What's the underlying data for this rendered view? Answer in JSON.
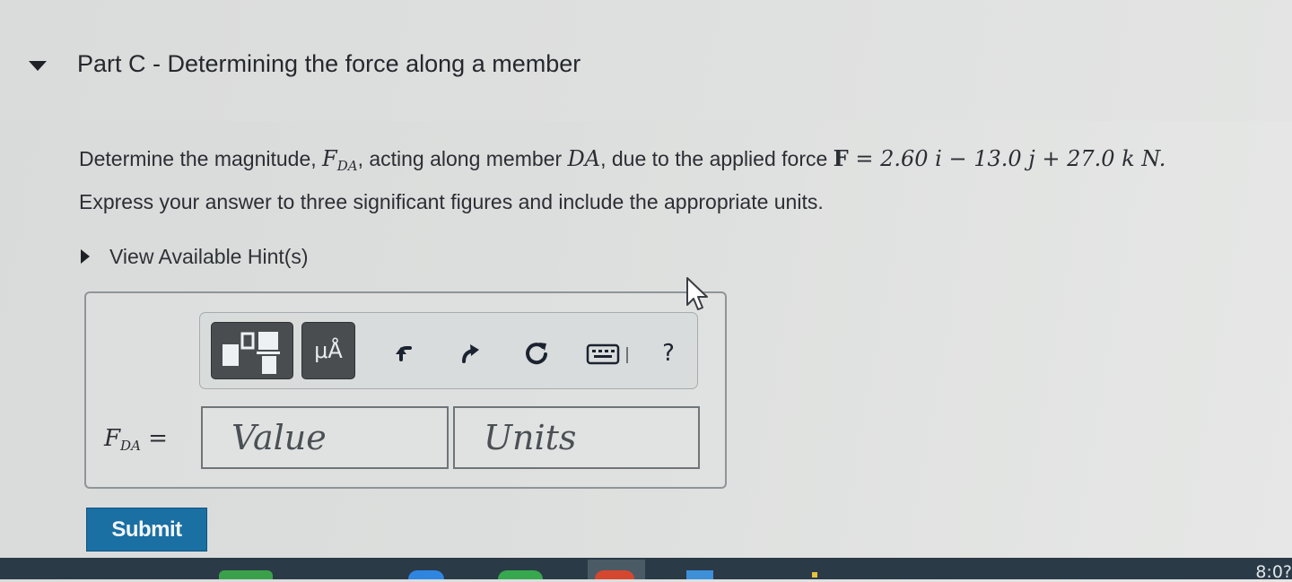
{
  "part": {
    "title": "Part C - Determining the force along a member"
  },
  "question": {
    "text_before": "Determine the magnitude, ",
    "symbol_main": "F",
    "symbol_sub": "DA",
    "text_middle1": ", acting along member ",
    "member": "DA",
    "text_middle2": ", due to the applied force ",
    "force_symbol": "F",
    "force_expression": " = 2.60 i − 13.0 j + 27.0 k N.",
    "instruction": "Express your answer to three significant figures and include the appropriate units."
  },
  "hints": {
    "label": "View Available Hint(s)"
  },
  "toolbar": {
    "units_label": "μÅ",
    "help_label": "?",
    "icons": [
      "templates-icon",
      "units-icon",
      "undo-icon",
      "redo-icon",
      "reset-icon",
      "keyboard-icon",
      "help-icon"
    ]
  },
  "answer": {
    "label_main": "F",
    "label_sub": "DA",
    "label_eq": " =",
    "value_placeholder": "Value",
    "units_placeholder": "Units"
  },
  "submit": {
    "label": "Submit"
  },
  "taskbar": {
    "clock": "8:0?"
  },
  "colors": {
    "submit_bg": "#1a6fa3",
    "toolbar_button_bg": "#4a4d50",
    "taskbar_bg": "#2a3a47"
  }
}
